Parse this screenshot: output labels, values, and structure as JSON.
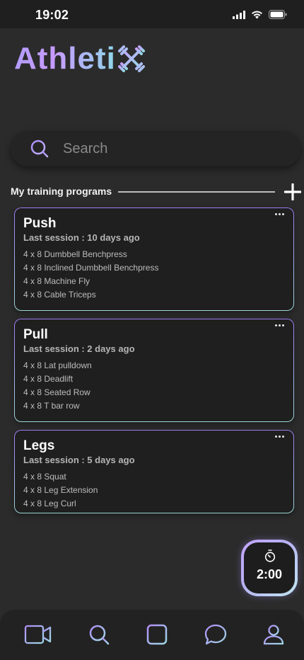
{
  "status_bar": {
    "time": "19:02"
  },
  "app": {
    "logo_text": "Athleti",
    "logo_mark_icon": "crossed-dumbbells-icon"
  },
  "search": {
    "placeholder": "Search",
    "value": ""
  },
  "section": {
    "title": "My training programs"
  },
  "programs": [
    {
      "title": "Push",
      "last_session": "Last session : 10 days ago",
      "exercises": [
        "4 x 8 Dumbbell Benchpress",
        "4 x 8 Inclined Dumbbell Benchpress",
        "4 x 8 Machine Fly",
        "4 x 8 Cable Triceps"
      ]
    },
    {
      "title": "Pull",
      "last_session": "Last session : 2 days ago",
      "exercises": [
        "4 x 8 Lat pulldown",
        "4 x 8 Deadlift",
        "4 x 8 Seated Row",
        "4 x 8 T bar row"
      ]
    },
    {
      "title": "Legs",
      "last_session": "Last session : 5 days ago",
      "exercises": [
        "4 x 8 Squat",
        "4 x 8 Leg Extension",
        "4 x 8 Leg Curl"
      ]
    }
  ],
  "timer": {
    "value": "2:00"
  },
  "tabbar": {
    "items": [
      "video-camera-icon",
      "search-icon",
      "add-square-icon",
      "chat-bubble-icon",
      "profile-icon"
    ]
  },
  "colors": {
    "accent_purple": "#b39cff",
    "accent_cyan": "#8fd6e8",
    "background": "#2b2b2b",
    "card": "#1f1f1f"
  }
}
